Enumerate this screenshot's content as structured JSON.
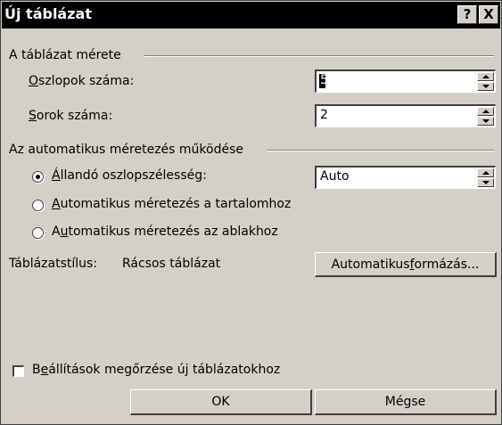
{
  "window": {
    "title": "Új táblázat",
    "help_label": "?",
    "close_label": "X"
  },
  "size_group": {
    "label": "A táblázat mérete",
    "columns": {
      "label_key": "O",
      "label_rest": "szlopok száma:",
      "value": "5"
    },
    "rows": {
      "label_key": "S",
      "label_rest": "orok száma:",
      "value": "2"
    }
  },
  "autofit_group": {
    "label": "Az automatikus méretezés működése",
    "options": [
      {
        "pre": "",
        "key": "Á",
        "post": "llandó oszlopszélesség:",
        "selected": true
      },
      {
        "pre": "",
        "key": "A",
        "post": "utomatikus méretezés a tartalomhoz",
        "selected": false
      },
      {
        "pre": "A",
        "key": "u",
        "post": "tomatikus méretezés az ablakhoz",
        "selected": false
      }
    ],
    "width_value": "Auto"
  },
  "style": {
    "label": "Táblázatstílus:",
    "value": "Rácsos táblázat",
    "autoformat_pre": "Automatikus ",
    "autoformat_key": "f",
    "autoformat_post": "ormázás..."
  },
  "remember": {
    "pre": "B",
    "key": "e",
    "post": "állítások megőrzése új táblázatokhoz",
    "checked": false
  },
  "buttons": {
    "ok": "OK",
    "cancel": "Mégse"
  }
}
